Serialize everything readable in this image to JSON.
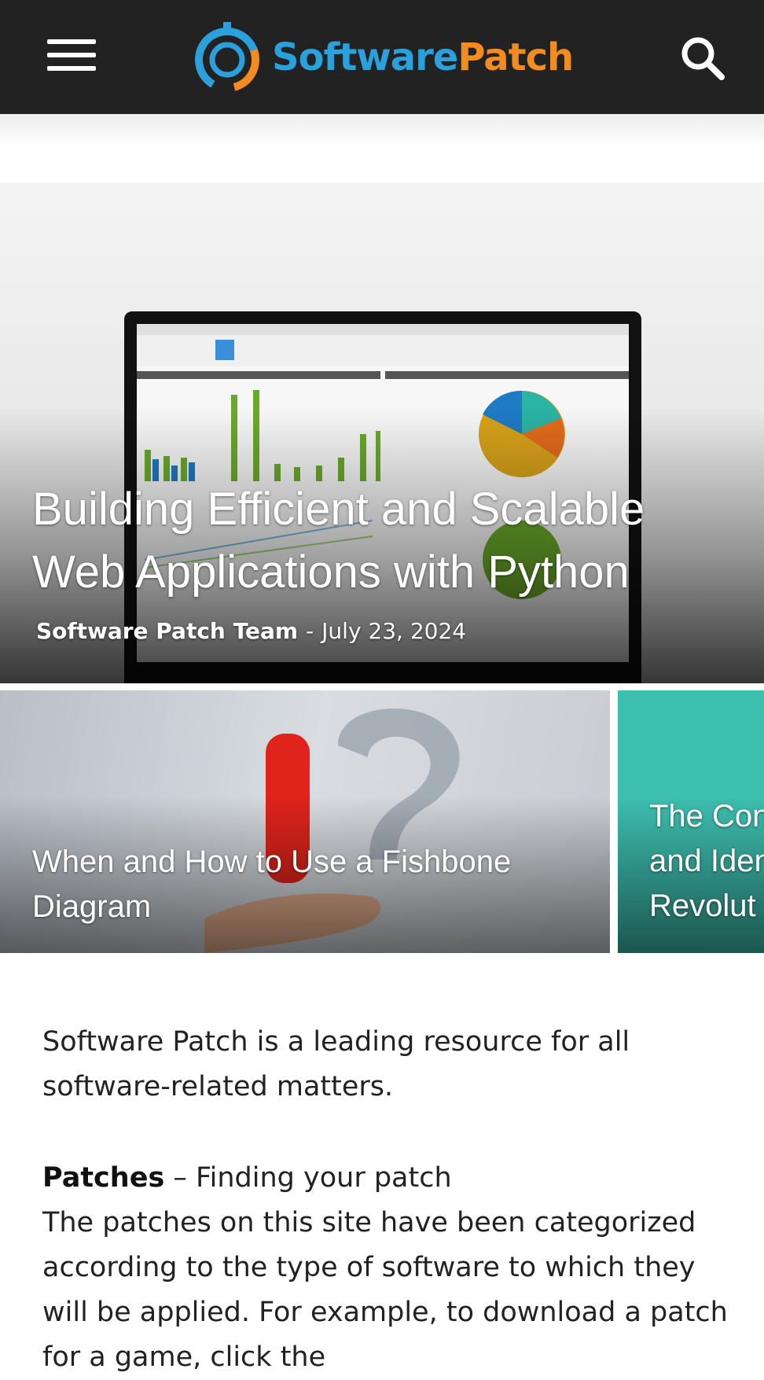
{
  "header": {
    "menu_icon": "hamburger-menu-icon",
    "logo": {
      "part1": "Software",
      "part2": "Patch",
      "color_primary": "#2aa0dd",
      "color_accent": "#f28b20"
    },
    "search_icon": "search-icon",
    "background": "#222222"
  },
  "hero": {
    "title": "Building Efficient and Scalable Web Applications with Python",
    "author": "Software Patch Team",
    "separator": "-",
    "date": "July 23, 2024"
  },
  "cards": [
    {
      "title": "When and How to Use a Fishbone Diagram"
    },
    {
      "title_lines": [
        "The Con",
        "and Iden",
        "Revolut"
      ]
    }
  ],
  "content": {
    "intro": "Software Patch is a leading resource for all software-related matters.",
    "patches_heading": "Patches",
    "patches_subheading": " – Finding your patch",
    "patches_text": "The patches on this site have been categorized according to the type of software to which they will be applied. For example, to download a patch for a game, click the"
  }
}
